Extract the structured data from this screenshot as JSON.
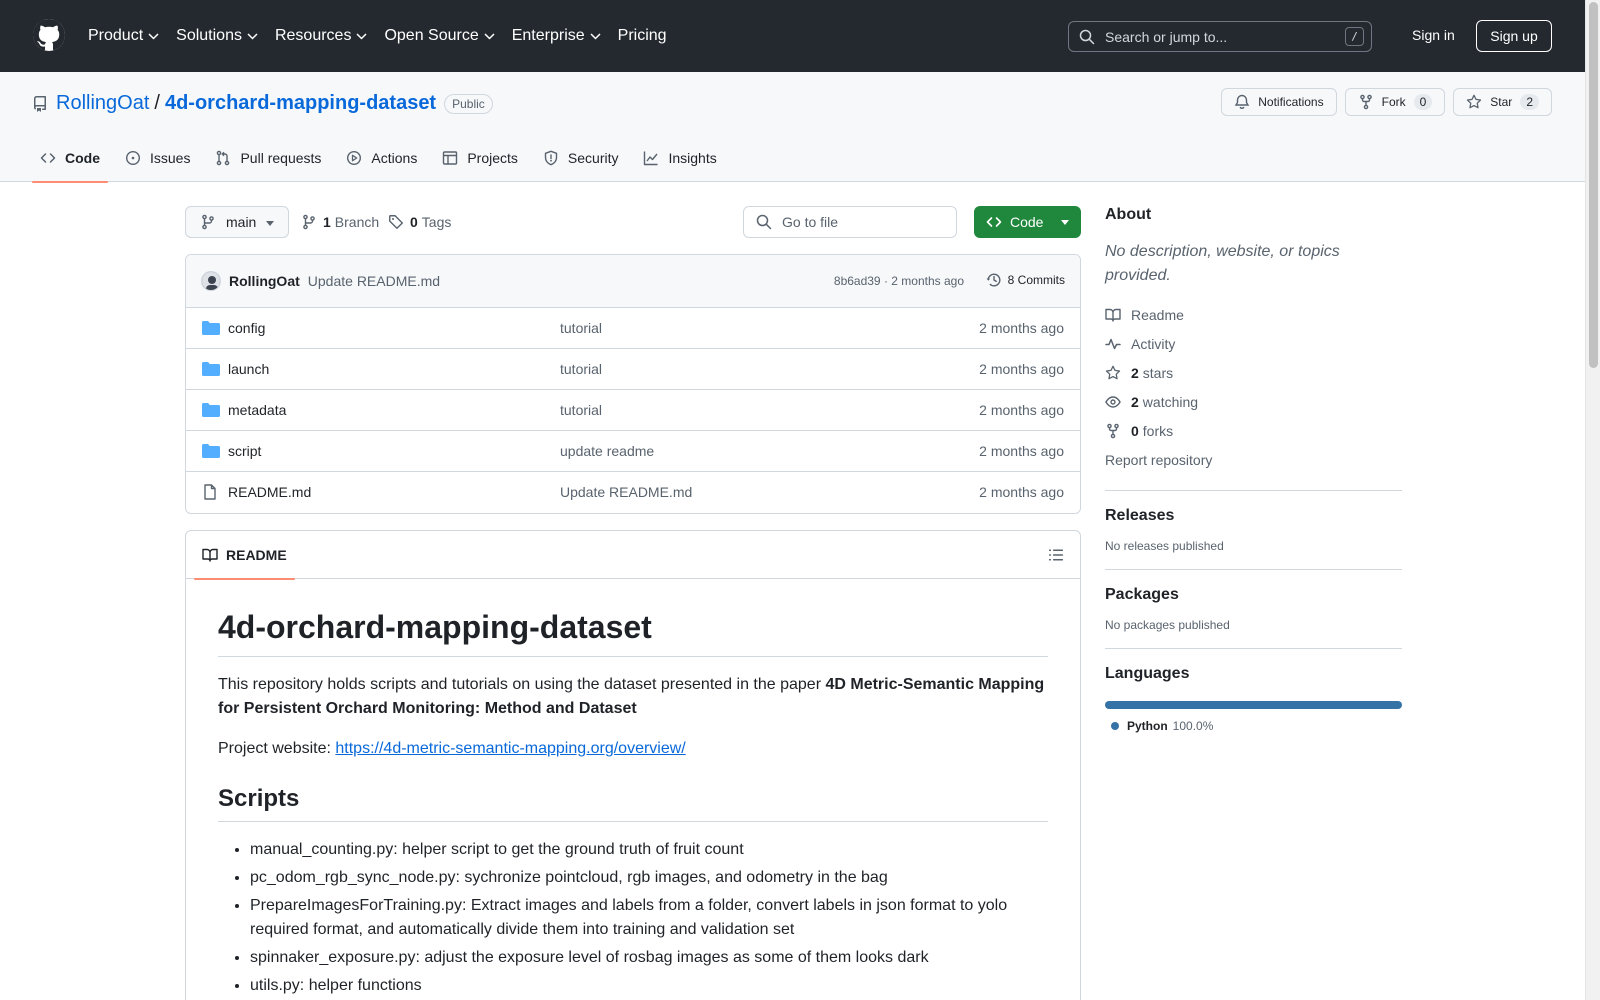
{
  "header": {
    "nav": [
      {
        "label": "Product",
        "has_caret": true
      },
      {
        "label": "Solutions",
        "has_caret": true
      },
      {
        "label": "Resources",
        "has_caret": true
      },
      {
        "label": "Open Source",
        "has_caret": true
      },
      {
        "label": "Enterprise",
        "has_caret": true
      },
      {
        "label": "Pricing",
        "has_caret": false
      }
    ],
    "search_placeholder": "Search or jump to...",
    "search_shortcut": "/",
    "sign_in": "Sign in",
    "sign_up": "Sign up"
  },
  "repo": {
    "owner": "RollingOat",
    "separator": "/",
    "name": "4d-orchard-mapping-dataset",
    "visibility": "Public",
    "notifications_label": "Notifications",
    "fork_label": "Fork",
    "fork_count": "0",
    "star_label": "Star",
    "star_count": "2"
  },
  "tabs": [
    {
      "label": "Code",
      "icon": "code-icon",
      "active": true
    },
    {
      "label": "Issues",
      "icon": "issue-icon",
      "active": false
    },
    {
      "label": "Pull requests",
      "icon": "pull-request-icon",
      "active": false
    },
    {
      "label": "Actions",
      "icon": "play-icon",
      "active": false
    },
    {
      "label": "Projects",
      "icon": "table-icon",
      "active": false
    },
    {
      "label": "Security",
      "icon": "shield-icon",
      "active": false
    },
    {
      "label": "Insights",
      "icon": "graph-icon",
      "active": false
    }
  ],
  "toolbar": {
    "branch": "main",
    "branch_count": "1",
    "branch_label": "Branch",
    "tag_count": "0",
    "tag_label": "Tags",
    "goto_placeholder": "Go to file",
    "code_button": "Code"
  },
  "latest_commit": {
    "author": "RollingOat",
    "message": "Update README.md",
    "meta": "8b6ad39 · 2 months ago",
    "commits_label": "8 Commits"
  },
  "files": [
    {
      "name": "config",
      "type": "folder",
      "message": "tutorial",
      "date": "2 months ago"
    },
    {
      "name": "launch",
      "type": "folder",
      "message": "tutorial",
      "date": "2 months ago"
    },
    {
      "name": "metadata",
      "type": "folder",
      "message": "tutorial",
      "date": "2 months ago"
    },
    {
      "name": "script",
      "type": "folder",
      "message": "update readme",
      "date": "2 months ago"
    },
    {
      "name": "README.md",
      "type": "file",
      "message": "Update README.md",
      "date": "2 months ago"
    }
  ],
  "readme": {
    "tab_label": "README",
    "title": "4d-orchard-mapping-dataset",
    "intro_prefix": "This repository holds scripts and tutorials on using the dataset presented in the paper ",
    "intro_bold": "4D Metric-Semantic Mapping for Persistent Orchard Monitoring: Method and Dataset",
    "website_label": "Project website: ",
    "website_url": "https://4d-metric-semantic-mapping.org/overview/",
    "scripts_heading": "Scripts",
    "scripts": [
      "manual_counting.py: helper script to get the ground truth of fruit count",
      "pc_odom_rgb_sync_node.py: sychronize pointcloud, rgb images, and odometry in the bag",
      "PrepareImagesForTraining.py: Extract images and labels from a folder, convert labels in json format to yolo required format, and automatically divide them into training and validation set",
      "spinnaker_exposure.py: adjust the exposure level of rosbag images as some of them looks dark",
      "utils.py: helper functions"
    ]
  },
  "sidebar": {
    "about_heading": "About",
    "about_desc": "No description, website, or topics provided.",
    "links": [
      {
        "icon": "book-icon",
        "count": "",
        "label": "Readme"
      },
      {
        "icon": "pulse-icon",
        "count": "",
        "label": "Activity"
      },
      {
        "icon": "star-icon",
        "count": "2",
        "label": "stars"
      },
      {
        "icon": "eye-icon",
        "count": "2",
        "label": "watching"
      },
      {
        "icon": "fork-icon",
        "count": "0",
        "label": "forks"
      }
    ],
    "report": "Report repository",
    "releases_heading": "Releases",
    "releases_text": "No releases published",
    "packages_heading": "Packages",
    "packages_text": "No packages published",
    "languages_heading": "Languages",
    "languages": [
      {
        "name": "Python",
        "percent": "100.0%",
        "color": "#3572A5",
        "fraction": 1.0
      }
    ]
  },
  "colors": {
    "header_bg": "#24292F",
    "link": "#0969DA",
    "primary_button": "#1F883D",
    "active_tab_underline": "#FD8C73",
    "folder": "#54AEFF"
  }
}
